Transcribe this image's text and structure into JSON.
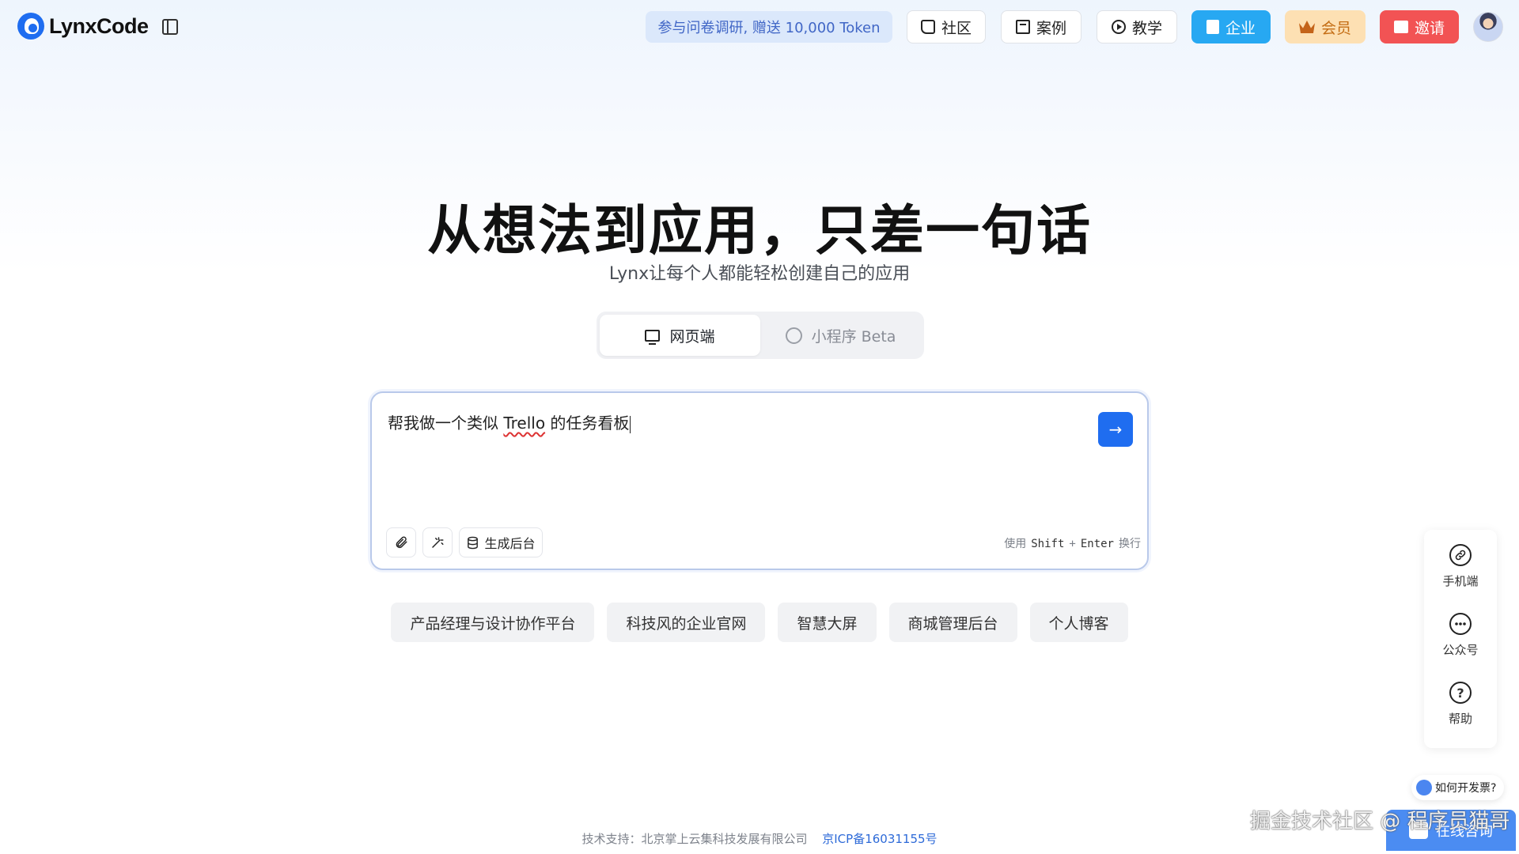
{
  "header": {
    "brand": "LynxCode",
    "survey_label": "参与问卷调研, 赠送 10,000 Token",
    "nav": {
      "community": "社区",
      "cases": "案例",
      "tutorial": "教学",
      "enterprise": "企业",
      "member": "会员",
      "invite": "邀请"
    }
  },
  "hero": {
    "title": "从想法到应用，只差一句话",
    "subtitle": "Lynx让每个人都能轻松创建自己的应用"
  },
  "mode_tabs": [
    {
      "label": "网页端",
      "active": true
    },
    {
      "label": "小程序 Beta",
      "active": false
    }
  ],
  "prompt": {
    "before": "帮我做一个类似 ",
    "word": "Trello",
    "after": " 的任务看板",
    "send_icon": "→",
    "tool_backend": "生成后台",
    "hint_use": "使用",
    "hint_shift": "Shift",
    "hint_plus": "+",
    "hint_enter": "Enter",
    "hint_newline": "换行"
  },
  "suggestions": [
    "产品经理与设计协作平台",
    "科技风的企业官网",
    "智慧大屏",
    "商城管理后台",
    "个人博客"
  ],
  "side_panel": {
    "mobile": "手机端",
    "official_account": "公众号",
    "help": "帮助",
    "help_icon": "?"
  },
  "floating": {
    "invoice": "如何开发票?",
    "consult": "在线咨询",
    "watermark": "掘金技术社区 @ 程序员猫哥"
  },
  "footer": {
    "support": "技术支持：北京掌上云集科技发展有限公司",
    "icp": "京ICP备16031155号"
  },
  "colors": {
    "accent": "#1f6df0",
    "enterprise": "#27a8f2",
    "member_bg": "#fde0b3",
    "invite": "#f25354"
  }
}
